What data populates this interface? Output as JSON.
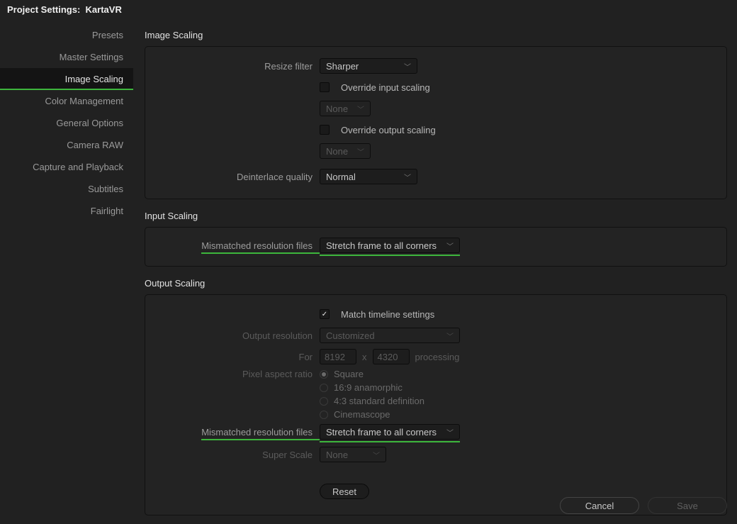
{
  "title_prefix": "Project Settings:",
  "title_project": "KartaVR",
  "sidebar": {
    "items": [
      {
        "label": "Presets"
      },
      {
        "label": "Master Settings"
      },
      {
        "label": "Image Scaling"
      },
      {
        "label": "Color Management"
      },
      {
        "label": "General Options"
      },
      {
        "label": "Camera RAW"
      },
      {
        "label": "Capture and Playback"
      },
      {
        "label": "Subtitles"
      },
      {
        "label": "Fairlight"
      }
    ]
  },
  "image_scaling": {
    "heading": "Image Scaling",
    "resize_filter_label": "Resize filter",
    "resize_filter_value": "Sharper",
    "override_input_label": "Override input scaling",
    "override_input_value": "None",
    "override_output_label": "Override output scaling",
    "override_output_value": "None",
    "deinterlace_label": "Deinterlace quality",
    "deinterlace_value": "Normal"
  },
  "input_scaling": {
    "heading": "Input Scaling",
    "mismatched_label": "Mismatched resolution files",
    "mismatched_value": "Stretch frame to all corners"
  },
  "output_scaling": {
    "heading": "Output Scaling",
    "match_timeline_label": "Match timeline settings",
    "output_res_label": "Output resolution",
    "output_res_value": "Customized",
    "for_label": "For",
    "for_w": "8192",
    "for_x": "x",
    "for_h": "4320",
    "processing_label": "processing",
    "par_label": "Pixel aspect ratio",
    "par_options": [
      "Square",
      "16:9 anamorphic",
      "4:3 standard definition",
      "Cinemascope"
    ],
    "mismatched_label": "Mismatched resolution files",
    "mismatched_value": "Stretch frame to all corners",
    "super_scale_label": "Super Scale",
    "super_scale_value": "None",
    "reset_label": "Reset"
  },
  "footer": {
    "cancel": "Cancel",
    "save": "Save"
  }
}
